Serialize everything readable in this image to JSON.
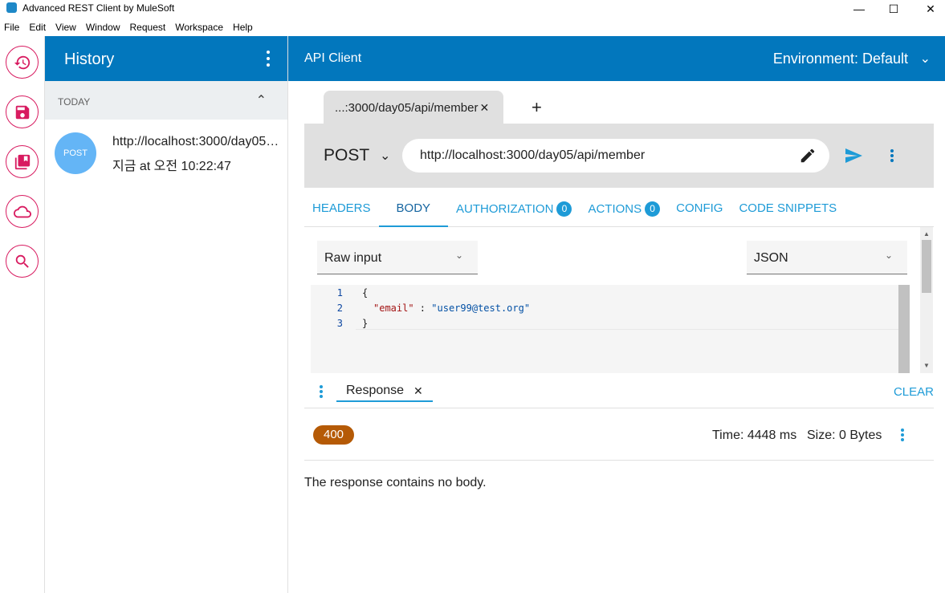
{
  "window": {
    "title": "Advanced REST Client by MuleSoft",
    "minimize": "—",
    "maximize": "☐",
    "close": "✕"
  },
  "menu": [
    "File",
    "Edit",
    "View",
    "Window",
    "Request",
    "Workspace",
    "Help"
  ],
  "rail": {
    "items": [
      "history-icon",
      "save-icon",
      "library-icon",
      "cloud-icon",
      "search-icon"
    ],
    "accent": "#d81b60"
  },
  "history": {
    "title": "History",
    "group": "TODAY",
    "items": [
      {
        "method": "POST",
        "url": "http://localhost:3000/day05/api/member",
        "time": "지금 at 오전 10:22:47"
      }
    ]
  },
  "main": {
    "title": "API Client",
    "environment": "Environment: Default"
  },
  "request_tab": {
    "label": "...:3000/day05/api/member",
    "close": "✕",
    "add": "+"
  },
  "request": {
    "method": "POST",
    "url": "http://localhost:3000/day05/api/member"
  },
  "tabs": {
    "headers": "HEADERS",
    "body": "BODY",
    "authorization": "AUTHORIZATION",
    "authorization_count": "0",
    "actions": "ACTIONS",
    "actions_count": "0",
    "config": "CONFIG",
    "snippets": "CODE SNIPPETS"
  },
  "body": {
    "editor_type": "Raw input",
    "content_type": "JSON",
    "lines": [
      {
        "n": "1",
        "text": "{"
      },
      {
        "n": "2",
        "key": "\"email\"",
        "sep": " : ",
        "value": "\"user99@test.org\""
      },
      {
        "n": "3",
        "text": "}"
      }
    ]
  },
  "response": {
    "tab_label": "Response",
    "close": "✕",
    "clear": "CLEAR",
    "status_code": "400",
    "status_color": "#b55a06",
    "time": "Time: 4448 ms",
    "size": "Size: 0 Bytes",
    "message": "The response contains no body."
  },
  "colors": {
    "header_bg": "#0277bd",
    "tab_accent": "#1e9bd7"
  }
}
